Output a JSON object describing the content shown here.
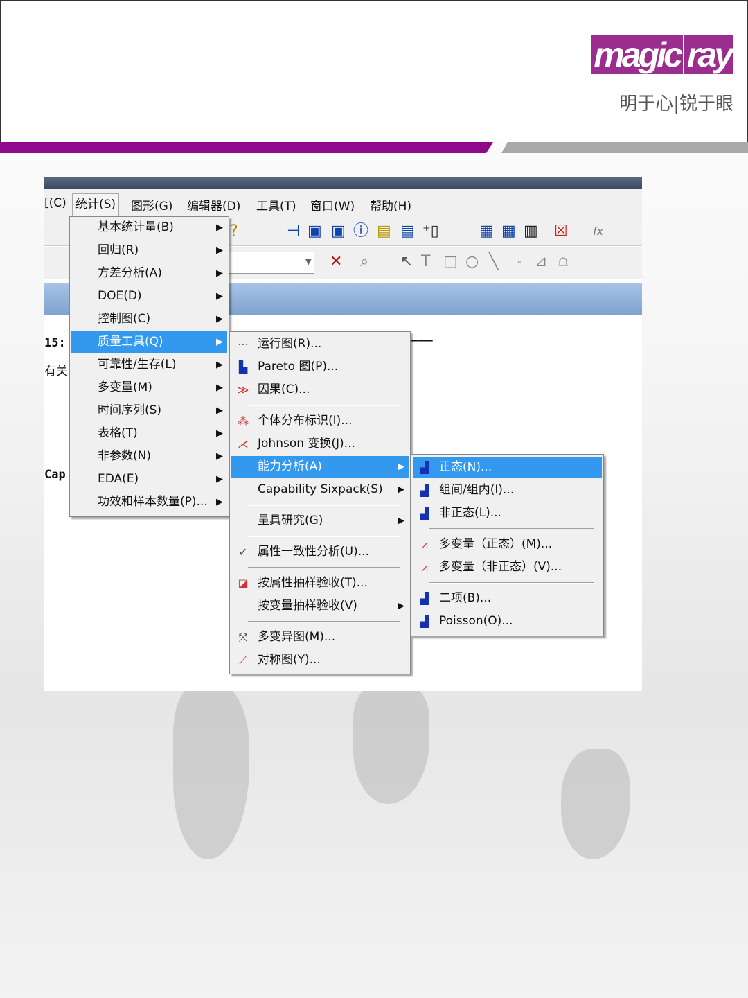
{
  "logo": {
    "brand": "magic",
    "brand_box": "ray",
    "tagline": "明于心|锐于眼"
  },
  "colors": {
    "accent_bar": "#8e0a8a",
    "selection": "#3399ee"
  },
  "menubar": [
    "[(C)",
    "统计(S)",
    "图形(G)",
    "编辑器(D)",
    "工具(T)",
    "窗口(W)",
    "帮助(H)"
  ],
  "background_text": {
    "line1": "15:",
    "line2": "有关",
    "line3": "Cap",
    "dashes": "———"
  },
  "stat_menu": [
    "基本统计量(B)",
    "回归(R)",
    "方差分析(A)",
    "DOE(D)",
    "控制图(C)",
    "质量工具(Q)",
    "可靠性/生存(L)",
    "多变量(M)",
    "时间序列(S)",
    "表格(T)",
    "非参数(N)",
    "EDA(E)",
    "功效和样本数量(P)..."
  ],
  "quality_menu": [
    "运行图(R)...",
    "Pareto 图(P)...",
    "因果(C)...",
    "个体分布标识(I)...",
    "Johnson 变换(J)...",
    "能力分析(A)",
    "Capability Sixpack(S)",
    "量具研究(G)",
    "属性一致性分析(U)...",
    "按属性抽样验收(T)...",
    "按变量抽样验收(V)",
    "多变异图(M)...",
    "对称图(Y)..."
  ],
  "capability_menu": [
    "正态(N)...",
    "组间/组内(I)...",
    "非正态(L)...",
    "多变量（正态）(M)...",
    "多变量（非正态）(V)...",
    "二项(B)...",
    "Poisson(O)..."
  ]
}
